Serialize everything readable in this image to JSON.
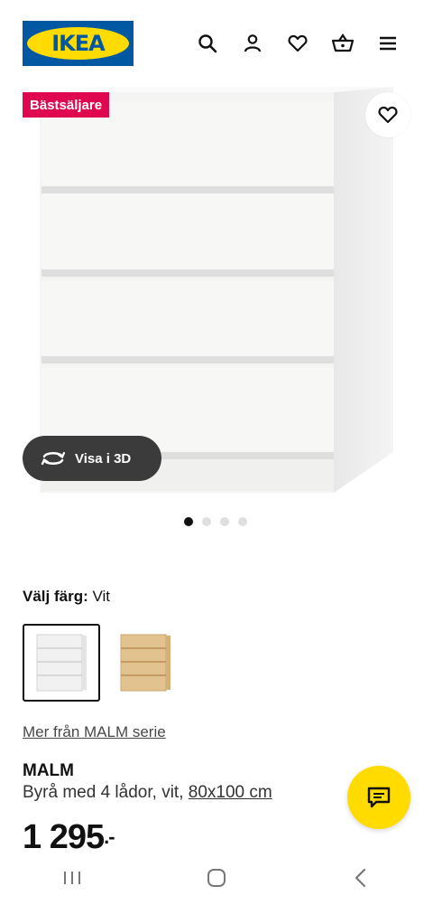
{
  "header": {
    "logo_text": "IKEA",
    "icons": [
      "search-icon",
      "user-icon",
      "heart-icon",
      "basket-icon",
      "menu-icon"
    ],
    "brand_blue": "#0058a3",
    "brand_yellow": "#ffdb00"
  },
  "product_image": {
    "badge": "Bästsäljare",
    "badge_color": "#e00751",
    "view_3d_label": "Visa i 3D",
    "carousel_total": 4,
    "carousel_active": 1
  },
  "color_select": {
    "label": "Välj färg:",
    "value": "Vit",
    "options": [
      {
        "name": "white-dresser-swatch",
        "selected": true
      },
      {
        "name": "oak-dresser-swatch",
        "selected": false
      }
    ]
  },
  "series_link": "Mer från MALM serie",
  "product": {
    "name": "MALM",
    "description": "Byrå med 4 lådor, vit,",
    "size": "80x100 cm",
    "price_main": "1 295",
    "price_sup": ".-"
  },
  "chat": {
    "icon": "chat-icon"
  },
  "system_nav": [
    "recent-apps-icon",
    "home-icon",
    "back-icon"
  ]
}
